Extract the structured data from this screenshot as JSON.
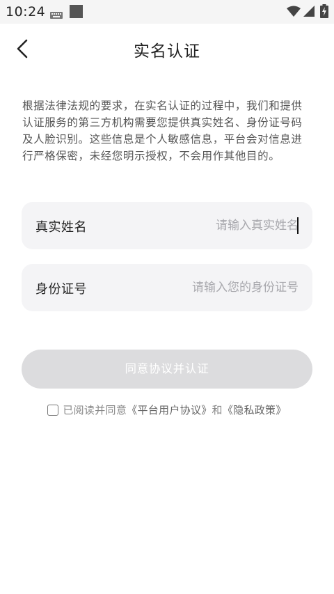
{
  "status_bar": {
    "time": "10:24"
  },
  "header": {
    "title": "实名认证"
  },
  "description": "根据法律法规的要求，在实名认证的过程中，我们和提供认证服务的第三方机构需要您提供真实姓名、身份证号码及人脸识别。这些信息是个人敏感信息，平台会对信息进行严格保密，未经您明示授权，不会用作其他目的。",
  "form": {
    "name_label": "真实姓名",
    "name_placeholder": "请输入真实姓名",
    "id_label": "身份证号",
    "id_placeholder": "请输入您的身份证号"
  },
  "submit_label": "同意协议并认证",
  "agreement": {
    "prefix": "已阅读并同意",
    "platform_link": "《平台用户协议》",
    "joiner": "和",
    "privacy_link": "《隐私政策》"
  },
  "colors": {
    "field_background": "#f4f4f6",
    "button_disabled": "#dcdcde"
  }
}
